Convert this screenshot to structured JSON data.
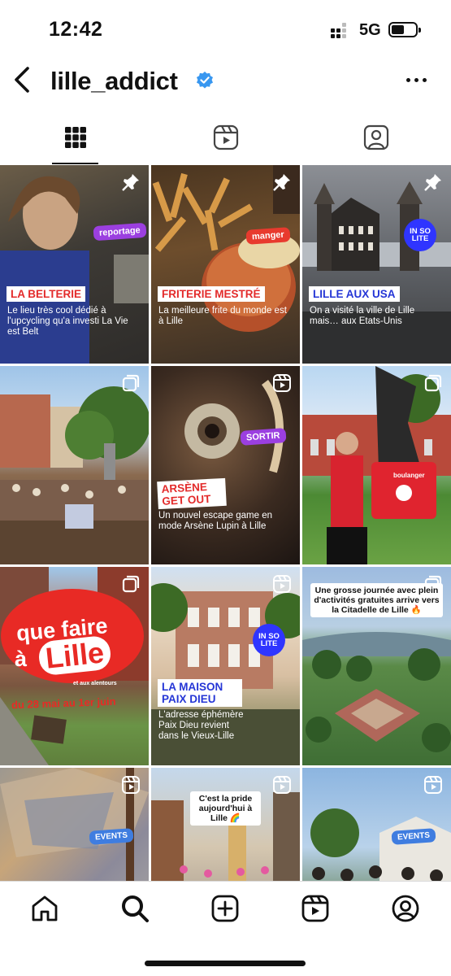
{
  "status_bar": {
    "time": "12:42",
    "network": "5G",
    "battery_level": 0.55
  },
  "header": {
    "back_icon": "chevron-left-icon",
    "username": "lille_addict",
    "verified_icon": "verified-badge-icon",
    "more_icon": "more-horizontal-icon"
  },
  "tabs": [
    {
      "name": "grid",
      "icon": "grid-icon",
      "active": true
    },
    {
      "name": "reels",
      "icon": "reels-icon",
      "active": false
    },
    {
      "name": "tagged",
      "icon": "tagged-user-icon",
      "active": false
    }
  ],
  "posts": [
    {
      "overlay": "pin-icon",
      "tag": "reportage",
      "title": "LA BELTERIE",
      "desc": "Le lieu très cool dédié à l'upcycling qu'a investi La Vie est Belt"
    },
    {
      "overlay": "pin-icon",
      "tag": "manger",
      "title": "FRITERIE MESTRÉ",
      "desc": "La meilleure frite du monde est à Lille"
    },
    {
      "overlay": "pin-icon",
      "badge": "IN SO LITE",
      "title": "LILLE AUX USA",
      "desc": "On a visité la ville de Lille mais… aux Etats-Unis"
    },
    {
      "overlay": "carousel-icon"
    },
    {
      "overlay": "reels-icon",
      "tag": "SORTIR",
      "title": "ARSÈNE GET OUT",
      "desc": "Un nouvel escape game en mode Arsène Lupin à Lille"
    },
    {
      "overlay": "carousel-icon",
      "shirt": "boulanger"
    },
    {
      "overlay": "carousel-icon",
      "big_title_1": "que faire",
      "big_title_2": "à",
      "big_title_3": "Lille",
      "subtitle": "et aux alentours",
      "dates": "du 28 mai au 1er juin"
    },
    {
      "overlay": "reels-icon",
      "badge": "IN SO LITE",
      "title": "LA MAISON PAIX DIEU",
      "desc": "L'adresse éphémère Paix Dieu revient dans le Vieux-Lille"
    },
    {
      "overlay": "carousel-icon",
      "caption": "Une grosse journée avec plein d'activités gratuites arrive vers la Citadelle de Lille 🔥"
    },
    {
      "overlay": "reels-icon",
      "tag": "EVENTS"
    },
    {
      "overlay": "reels-icon",
      "caption": "C'est la pride aujourd'hui à Lille 🌈"
    },
    {
      "overlay": "reels-icon",
      "tag": "EVENTS"
    }
  ],
  "bottom_nav": [
    {
      "name": "home",
      "icon": "home-icon"
    },
    {
      "name": "search",
      "icon": "search-icon",
      "active": true
    },
    {
      "name": "create",
      "icon": "plus-square-icon"
    },
    {
      "name": "reels",
      "icon": "reels-icon"
    },
    {
      "name": "profile",
      "icon": "profile-icon"
    }
  ],
  "colors": {
    "verified_blue": "#3897f0",
    "tag_purple": "#9b3fe0",
    "tag_red": "#e83a2e",
    "insolite_blue": "#2f35ff",
    "title_red": "#e32b2b",
    "title_blue": "#2536d6"
  }
}
